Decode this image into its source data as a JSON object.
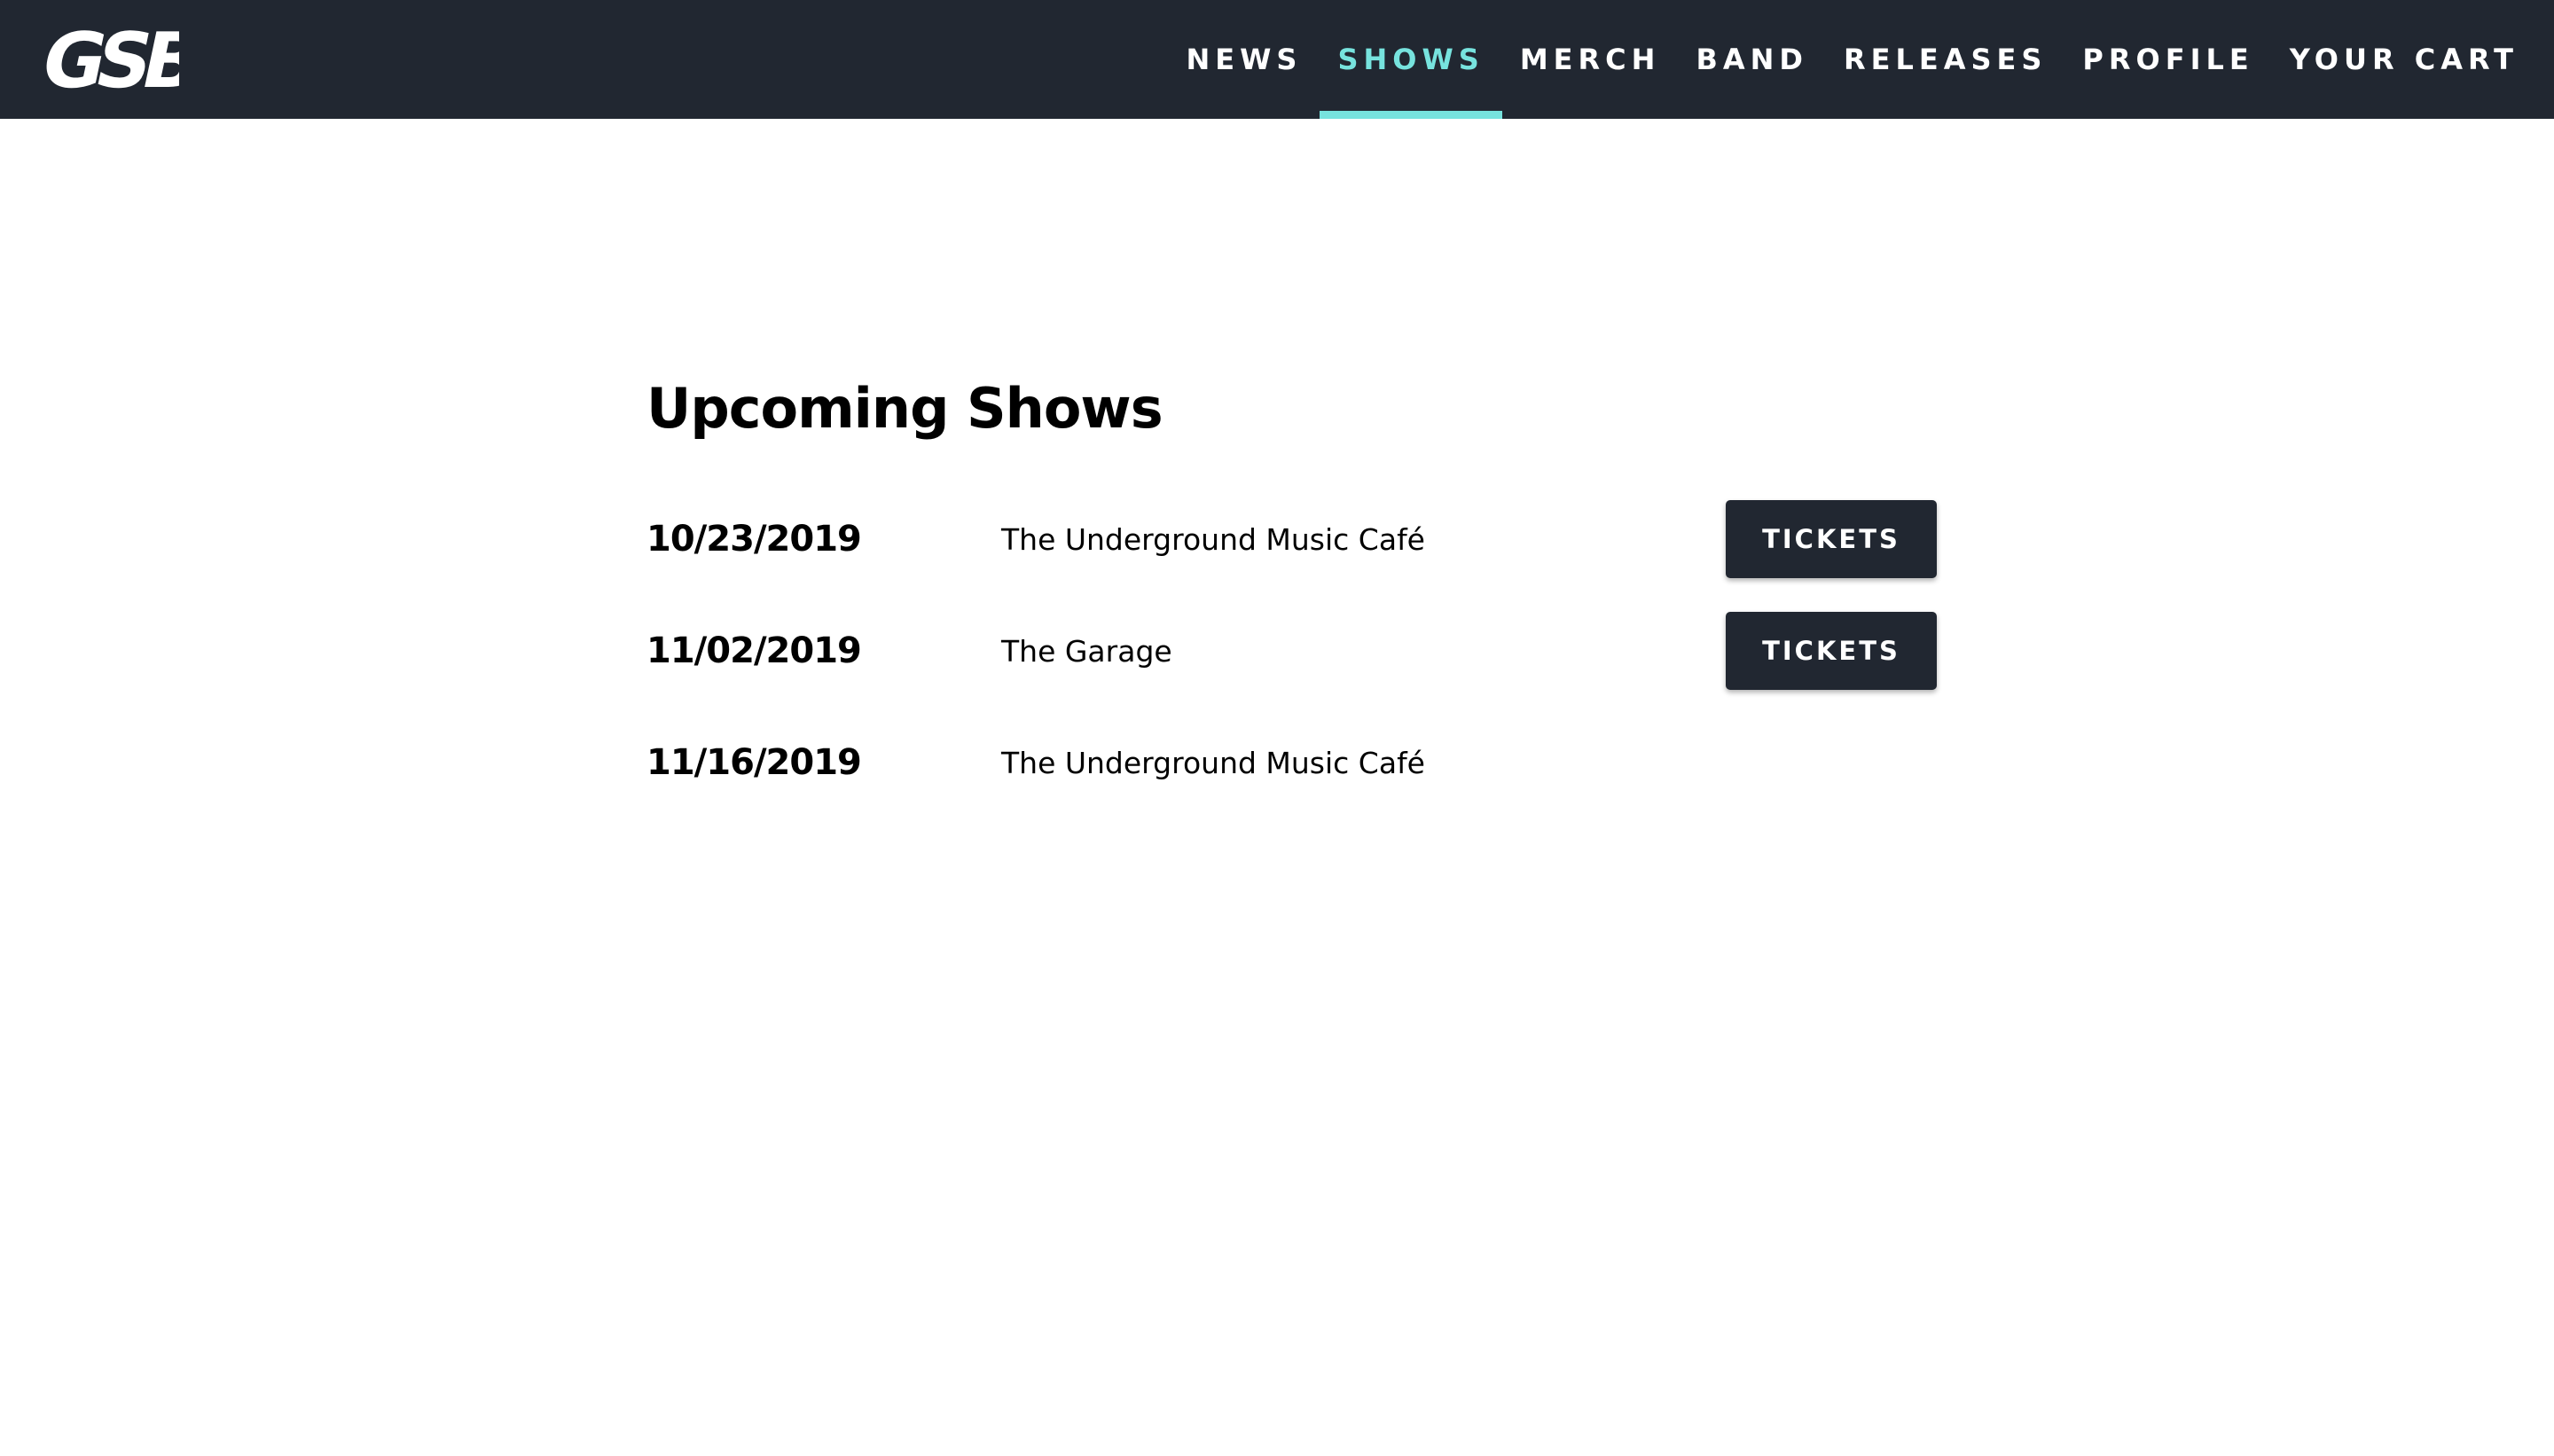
{
  "header": {
    "logo_text": "GSB",
    "nav": [
      {
        "label": "NEWS",
        "active": false
      },
      {
        "label": "SHOWS",
        "active": true
      },
      {
        "label": "MERCH",
        "active": false
      },
      {
        "label": "BAND",
        "active": false
      },
      {
        "label": "RELEASES",
        "active": false
      },
      {
        "label": "PROFILE",
        "active": false
      },
      {
        "label": "YOUR CART",
        "active": false
      }
    ]
  },
  "main": {
    "title": "Upcoming Shows",
    "shows": [
      {
        "date": "10/23/2019",
        "venue": "The Underground Music Café",
        "tickets_label": "TICKETS"
      },
      {
        "date": "11/02/2019",
        "venue": "The Garage",
        "tickets_label": "TICKETS"
      },
      {
        "date": "11/16/2019",
        "venue": "The Underground Music Café"
      }
    ]
  },
  "colors": {
    "header_bg": "#212731",
    "accent": "#77e3de",
    "button_bg": "#212731",
    "text": "#000000"
  }
}
